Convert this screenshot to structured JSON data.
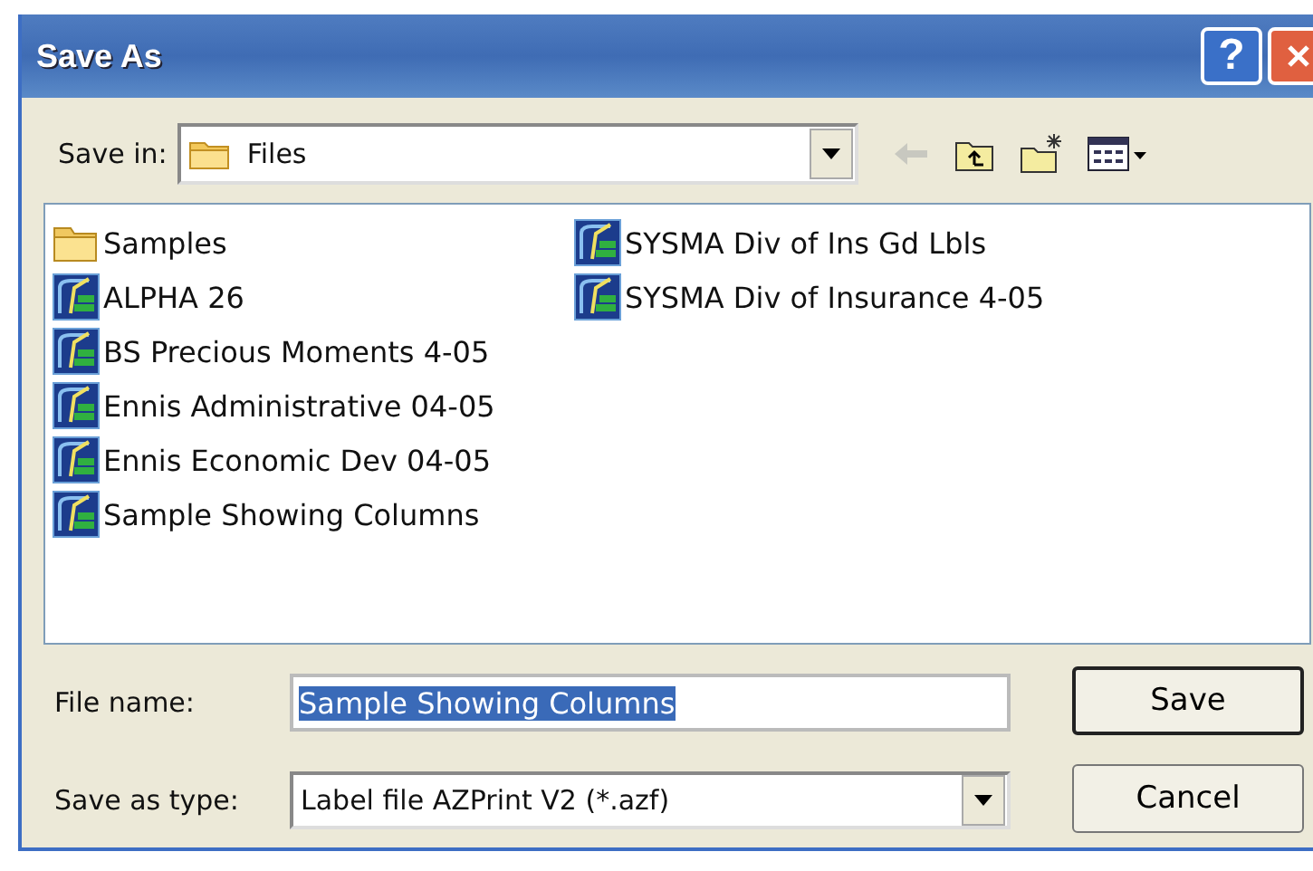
{
  "window": {
    "title": "Save As",
    "buttons": [
      {
        "kind": "help",
        "label": "?"
      },
      {
        "kind": "close"
      }
    ]
  },
  "save_in": {
    "label": "Save in:",
    "value": "Files"
  },
  "files": [
    {
      "kind": "folder",
      "name": "Samples"
    },
    {
      "kind": "label-file",
      "name": "ALPHA 26"
    },
    {
      "kind": "label-file",
      "name": "BS Precious Moments 4-05"
    },
    {
      "kind": "label-file",
      "name": "Ennis Administrative 04-05"
    },
    {
      "kind": "label-file",
      "name": "Ennis Economic Dev 04-05"
    },
    {
      "kind": "label-file",
      "name": "Sample Showing Columns"
    },
    {
      "kind": "label-file",
      "name": "SYSMA Div of Ins Gd Lbls"
    },
    {
      "kind": "label-file",
      "name": "SYSMA Div of Insurance 4-05"
    }
  ],
  "file_name": {
    "label": "File name:",
    "value": "Sample Showing Columns",
    "text_selected": true
  },
  "save_as_type": {
    "label": "Save as type:",
    "value": "Label file AZPrint V2 (*.azf)"
  },
  "actions": [
    {
      "label": "Save",
      "default": true
    },
    {
      "label": "Cancel",
      "default": false
    }
  ]
}
